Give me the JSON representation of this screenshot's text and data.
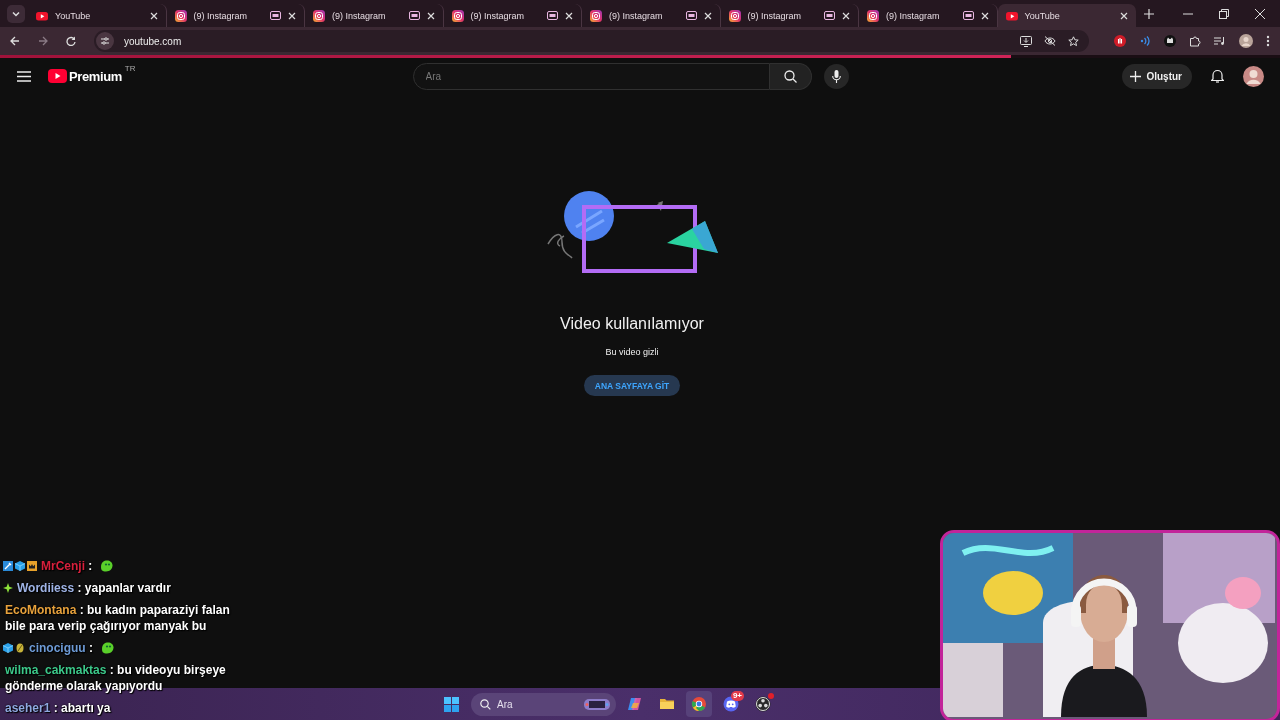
{
  "browser": {
    "tabs": [
      {
        "title": "YouTube",
        "kind": "youtube",
        "media_icon": false,
        "selected": false
      },
      {
        "title": "(9) Instagram",
        "kind": "instagram",
        "media_icon": true,
        "selected": false
      },
      {
        "title": "(9) Instagram",
        "kind": "instagram",
        "media_icon": true,
        "selected": false
      },
      {
        "title": "(9) Instagram",
        "kind": "instagram",
        "media_icon": true,
        "selected": false
      },
      {
        "title": "(9) Instagram",
        "kind": "instagram",
        "media_icon": true,
        "selected": false
      },
      {
        "title": "(9) Instagram",
        "kind": "instagram",
        "media_icon": true,
        "selected": false
      },
      {
        "title": "(9) Instagram",
        "kind": "instagram",
        "media_icon": true,
        "selected": false
      },
      {
        "title": "YouTube",
        "kind": "youtube",
        "media_icon": false,
        "selected": true
      }
    ],
    "address": "youtube.com",
    "loading": {
      "level": 0.79
    }
  },
  "youtube": {
    "logo_text": "Premium",
    "region": "TR",
    "search": {
      "placeholder": "Ara"
    },
    "create_button": "Oluştur",
    "notice": {
      "title": "Video kullanılamıyor",
      "subtitle": "Bu video gizli",
      "button": "ANA SAYFAYA GİT"
    }
  },
  "chat": [
    {
      "kind": "emote",
      "badges": [
        {
          "kind": "tool"
        },
        {
          "kind": "cube"
        },
        {
          "kind": "crown"
        }
      ],
      "user": "MrCenji",
      "color": "#d8203c",
      "text": ":"
    },
    {
      "kind": "text",
      "badges": [
        {
          "kind": "star"
        }
      ],
      "user": "Wordiiess",
      "color": "#9fb4e6",
      "text": ": yapanlar vardır"
    },
    {
      "kind": "text",
      "user": "EcoMontana",
      "color": "#e8a23c",
      "text": ": bu kadın paparaziyi falan bile para verip çağırıyor manyak bu"
    },
    {
      "kind": "emote",
      "badges": [
        {
          "kind": "cube"
        },
        {
          "kind": "pin"
        }
      ],
      "user": "cinociguu",
      "color": "#6e9bd6",
      "text": ":"
    },
    {
      "kind": "text",
      "user": "wilma_cakmaktas",
      "color": "#3cc98a",
      "text": ": bu videoyu birşeye gönderme olarak yapıyordu"
    },
    {
      "kind": "text",
      "user": "aseher1",
      "color": "#8fa8e0",
      "text": ": abartı ya"
    }
  ],
  "taskbar": {
    "search": {
      "placeholder": "Ara"
    },
    "apps": [
      {
        "kind": "copilot",
        "active": false
      },
      {
        "kind": "folder",
        "active": false
      },
      {
        "kind": "chrome",
        "active": true
      },
      {
        "kind": "discord",
        "active": false,
        "badge": "9+"
      },
      {
        "kind": "obs",
        "active": false,
        "alert": true
      }
    ]
  }
}
